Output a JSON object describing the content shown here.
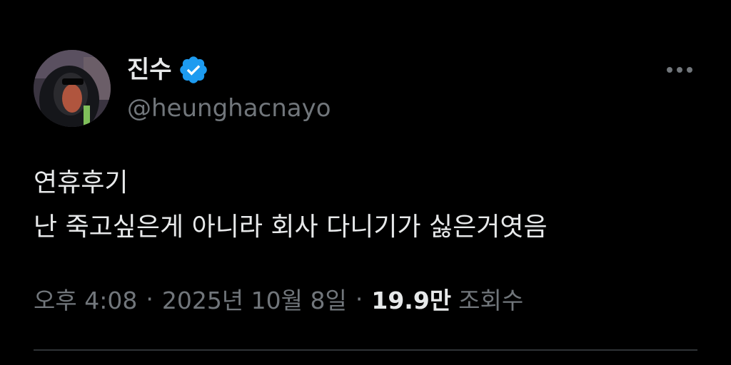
{
  "author": {
    "display_name": "진수",
    "handle": "@heunghacnayo",
    "verified_icon": "verified-badge-icon",
    "avatar_icon": "avatar-image"
  },
  "more_menu_icon": "more-options-icon",
  "tweet": {
    "lines": [
      "연휴후기",
      "난 죽고싶은게 아니라 회사 다니기가 싫은거엿음"
    ]
  },
  "meta": {
    "time": "오후 4:08",
    "separator": "·",
    "date": "2025년 10월 8일",
    "views_count": "19.9만",
    "views_label": "조회수"
  },
  "colors": {
    "background": "#000000",
    "primary_text": "#e7e9ea",
    "secondary_text": "#71767b",
    "verified_blue": "#1d9bf0",
    "divider": "#2f3336"
  }
}
